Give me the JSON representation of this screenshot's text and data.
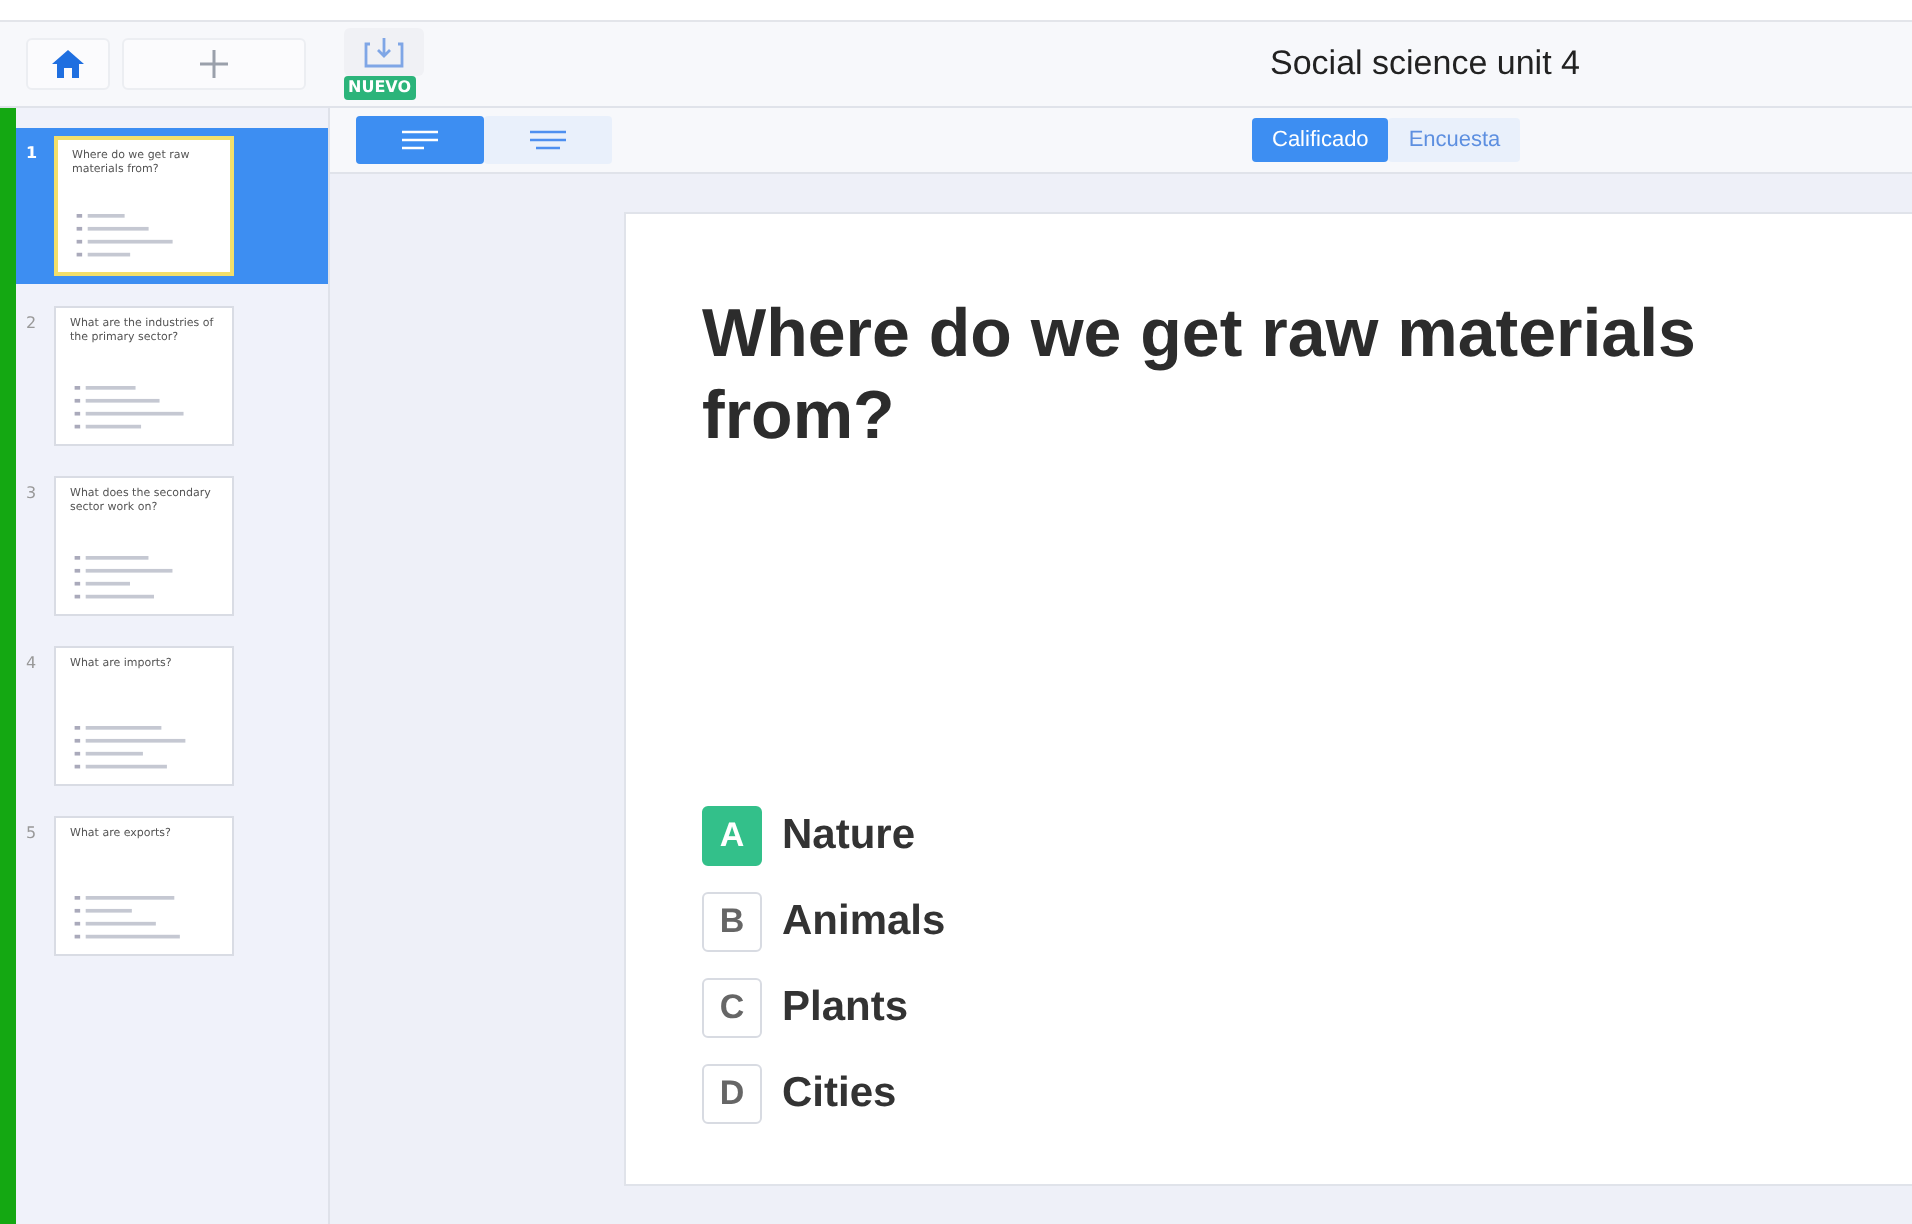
{
  "top_bar": {
    "badge": "NUEVO",
    "title": "Social science unit 4"
  },
  "slides": [
    {
      "number": "1",
      "question": "Where do we get raw materials from?",
      "selected": true
    },
    {
      "number": "2",
      "question": "What are the industries of the primary sector?",
      "selected": false
    },
    {
      "number": "3",
      "question": "What does the secondary sector work on?",
      "selected": false
    },
    {
      "number": "4",
      "question": "What are imports?",
      "selected": false
    },
    {
      "number": "5",
      "question": "What are exports?",
      "selected": false
    }
  ],
  "format_buttons": [
    {
      "kind": "align-left",
      "selected": true
    },
    {
      "kind": "align-center",
      "selected": false
    }
  ],
  "mode_tabs": [
    {
      "label": "Calificado",
      "selected": true
    },
    {
      "label": "Encuesta",
      "selected": false
    }
  ],
  "question": {
    "text": "Where do we get raw materials from?",
    "answers": [
      {
        "letter": "A",
        "text": "Nature",
        "correct": true
      },
      {
        "letter": "B",
        "text": "Animals",
        "correct": false
      },
      {
        "letter": "C",
        "text": "Plants",
        "correct": false
      },
      {
        "letter": "D",
        "text": "Cities",
        "correct": false
      }
    ]
  }
}
